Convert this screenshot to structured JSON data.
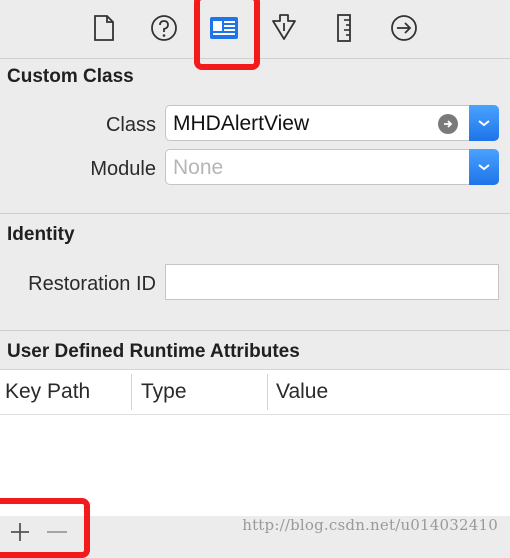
{
  "toolbar": {
    "icons": [
      "file-icon",
      "help-icon",
      "identity-icon",
      "attributes-icon",
      "size-icon",
      "connections-icon"
    ],
    "selected": "identity-icon"
  },
  "custom_class": {
    "title": "Custom Class",
    "class_label": "Class",
    "class_value": "MHDAlertView",
    "module_label": "Module",
    "module_placeholder": "None"
  },
  "identity": {
    "title": "Identity",
    "restoration_label": "Restoration ID",
    "restoration_value": ""
  },
  "runtime_attributes": {
    "title": "User Defined Runtime Attributes",
    "columns": [
      "Key Path",
      "Type",
      "Value"
    ]
  },
  "footer": {
    "watermark": "http://blog.csdn.net/u014032410"
  },
  "colors": {
    "highlight": "#f21a1a",
    "accent": "#1e74e8"
  }
}
